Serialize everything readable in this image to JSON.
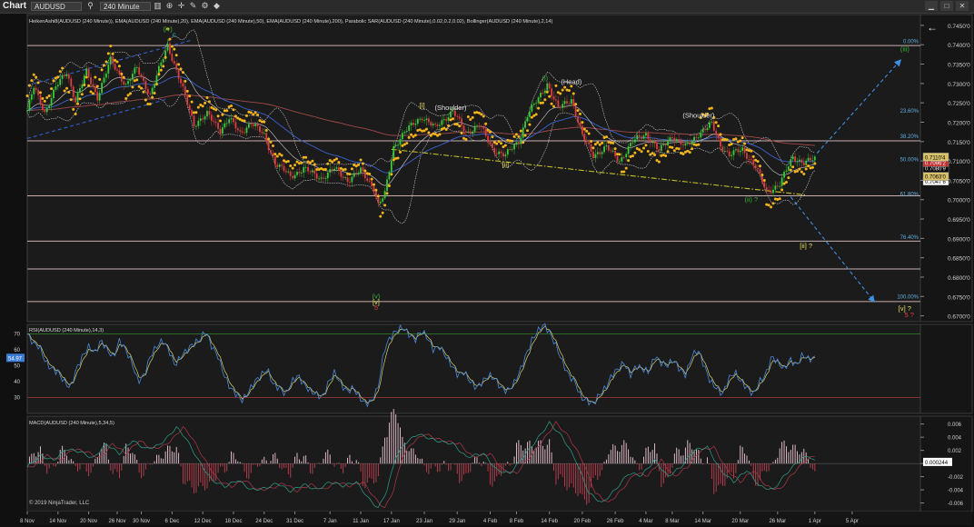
{
  "window": {
    "title": "Chart",
    "instrument": "AUDUSD",
    "timeframe": "240 Minute",
    "icons": [
      "search-icon",
      "dropdown-icon",
      "bars-icon",
      "zoom-icon",
      "crosshair-icon",
      "draw-icon",
      "settings-icon",
      "pin-icon",
      "minimize-icon",
      "maximize-icon",
      "close-icon"
    ],
    "back_arrow": "←",
    "copyright": "© 2019 NinjaTrader, LLC"
  },
  "chart_data": [
    {
      "type": "candlestick",
      "title": "HeikenAshi8(AUDUSD (240 Minute)), EMA(AUDUSD (240 Minute),20), EMA(AUDUSD (240 Minute),50), EMA(AUDUSD (240 Minute),200), Parabolic SAR(AUDUSD (240 Minute),0.02,0.2,0.02), Bollinger(AUDUSD (240 Minute),2,14)",
      "x_ticks": [
        "8 Nov",
        "14 Nov",
        "20 Nov",
        "26 Nov",
        "30 Nov",
        "6 Dec",
        "12 Dec",
        "18 Dec",
        "24 Dec",
        "31 Dec",
        "7 Jan",
        "11 Jan",
        "17 Jan",
        "23 Jan",
        "29 Jan",
        "4 Feb",
        "8 Feb",
        "14 Feb",
        "20 Feb",
        "26 Feb",
        "4 Mar",
        "8 Mar",
        "14 Mar",
        "20 Mar",
        "26 Mar",
        "1 Apr",
        "5 Apr"
      ],
      "y_ticks": [
        "0.7450'0",
        "0.7400'0",
        "0.7350'0",
        "0.7300'0",
        "0.7250'0",
        "0.7200'0",
        "0.7150'0",
        "0.7100'0",
        "0.7050'0",
        "0.7000'0",
        "0.6950'0",
        "0.6900'0",
        "0.6850'0",
        "0.6800'0",
        "0.6750'0",
        "0.6700'0"
      ],
      "ylim": [
        0.6685,
        0.7478
      ],
      "price_path": [
        [
          0,
          0.723
        ],
        [
          3,
          0.729
        ],
        [
          8,
          0.7225
        ],
        [
          13,
          0.729
        ],
        [
          18,
          0.733
        ],
        [
          22,
          0.7255
        ],
        [
          27,
          0.733
        ],
        [
          32,
          0.7265
        ],
        [
          38,
          0.736
        ],
        [
          45,
          0.7295
        ],
        [
          50,
          0.734
        ],
        [
          56,
          0.727
        ],
        [
          64,
          0.74
        ],
        [
          70,
          0.73
        ],
        [
          76,
          0.7195
        ],
        [
          82,
          0.722
        ],
        [
          88,
          0.718
        ],
        [
          92,
          0.721
        ],
        [
          97,
          0.717
        ],
        [
          102,
          0.72
        ],
        [
          108,
          0.7165
        ],
        [
          113,
          0.7095
        ],
        [
          120,
          0.706
        ],
        [
          126,
          0.708
        ],
        [
          134,
          0.7055
        ],
        [
          140,
          0.708
        ],
        [
          146,
          0.705
        ],
        [
          152,
          0.7075
        ],
        [
          158,
          0.703
        ],
        [
          160,
          0.6985
        ],
        [
          163,
          0.7015
        ],
        [
          167,
          0.7135
        ],
        [
          172,
          0.7175
        ],
        [
          180,
          0.7215
        ],
        [
          186,
          0.7185
        ],
        [
          194,
          0.723
        ],
        [
          200,
          0.717
        ],
        [
          206,
          0.7195
        ],
        [
          212,
          0.713
        ],
        [
          218,
          0.7115
        ],
        [
          224,
          0.715
        ],
        [
          228,
          0.722
        ],
        [
          233,
          0.726
        ],
        [
          237,
          0.73
        ],
        [
          242,
          0.7235
        ],
        [
          248,
          0.726
        ],
        [
          253,
          0.7165
        ],
        [
          258,
          0.7115
        ],
        [
          264,
          0.7135
        ],
        [
          270,
          0.71
        ],
        [
          276,
          0.715
        ],
        [
          282,
          0.717
        ],
        [
          288,
          0.7125
        ],
        [
          294,
          0.7165
        ],
        [
          300,
          0.7135
        ],
        [
          306,
          0.717
        ],
        [
          312,
          0.7195
        ],
        [
          316,
          0.714
        ],
        [
          320,
          0.7115
        ],
        [
          326,
          0.713
        ],
        [
          332,
          0.7085
        ],
        [
          337,
          0.702
        ],
        [
          343,
          0.704
        ],
        [
          349,
          0.711
        ],
        [
          354,
          0.7095
        ],
        [
          359,
          0.7105
        ]
      ],
      "sar_segments": [
        {
          "start": 0,
          "end": 16,
          "side": "above"
        },
        {
          "start": 17,
          "end": 30,
          "side": "below"
        },
        {
          "start": 31,
          "end": 44,
          "side": "above"
        },
        {
          "start": 45,
          "end": 63,
          "side": "below"
        },
        {
          "start": 64,
          "end": 160,
          "side": "above"
        },
        {
          "start": 161,
          "end": 200,
          "side": "below"
        },
        {
          "start": 201,
          "end": 225,
          "side": "above"
        },
        {
          "start": 226,
          "end": 240,
          "side": "below"
        },
        {
          "start": 241,
          "end": 270,
          "side": "above"
        },
        {
          "start": 271,
          "end": 306,
          "side": "below"
        },
        {
          "start": 307,
          "end": 336,
          "side": "above"
        },
        {
          "start": 337,
          "end": 359,
          "side": "below"
        }
      ],
      "horizontal_levels": [
        0.7398,
        0.7152,
        0.701,
        0.6893,
        0.6821,
        0.6737
      ],
      "fib_labels": [
        {
          "label": "0.00%",
          "price": 0.7402
        },
        {
          "label": "23.60%",
          "price": 0.7222
        },
        {
          "label": "38.20%",
          "price": 0.7157
        },
        {
          "label": "50.00%",
          "price": 0.7097
        },
        {
          "label": "61.80%",
          "price": 0.7008
        },
        {
          "label": "76.40%",
          "price": 0.6896
        },
        {
          "label": "100.00%",
          "price": 0.6742
        }
      ],
      "price_labels": [
        {
          "text": "0.7080'9",
          "color": "#ffffff",
          "fill": "#000000",
          "price": 0.7081
        },
        {
          "text": "0.7047'6",
          "color": "#000000",
          "fill": "#ffffff",
          "price": 0.7048
        },
        {
          "text": "0.7096'2",
          "color": "#ffffff",
          "fill": "#c03030",
          "price": 0.7096
        },
        {
          "text": "0.7063'0",
          "color": "#000000",
          "fill": "#d9c26a",
          "price": 0.706
        },
        {
          "text": "0.7110'4",
          "color": "#000000",
          "fill": "#d9c26a",
          "price": 0.711
        }
      ],
      "wave_labels": [
        {
          "text": "(iv)",
          "color": "#38b038",
          "i": 64,
          "price": 0.7435
        },
        {
          "text": "c",
          "color": "#38c0c0",
          "i": 67,
          "price": 0.742
        },
        {
          "text": "(v)",
          "color": "#38b038",
          "i": 159,
          "price": 0.6745
        },
        {
          "text": "[v]",
          "color": "#e8e060",
          "i": 159,
          "price": 0.673
        },
        {
          "text": "5",
          "color": "#e04040",
          "i": 159,
          "price": 0.6716
        },
        {
          "text": "[i]",
          "color": "#e8e060",
          "i": 180,
          "price": 0.7238
        },
        {
          "text": "(Shoulder)",
          "color": "#e0e0e0",
          "i": 193,
          "price": 0.7232
        },
        {
          "text": "[ii]",
          "color": "#e8e060",
          "i": 218,
          "price": 0.7085
        },
        {
          "text": "(i)",
          "color": "#38b038",
          "i": 236,
          "price": 0.7308
        },
        {
          "text": "(Head)",
          "color": "#e0e0e0",
          "i": 248,
          "price": 0.7298
        },
        {
          "text": "(Shoulder)",
          "color": "#e0e0e0",
          "i": 306,
          "price": 0.7212
        },
        {
          "text": "(ii) ?",
          "color": "#38b038",
          "i": 330,
          "price": 0.6995
        },
        {
          "text": "(iii)",
          "color": "#38b038",
          "i": 400,
          "price": 0.7383
        },
        {
          "text": "[ii] ?",
          "color": "#e8e060",
          "i": 355,
          "price": 0.6875
        },
        {
          "text": "[v] ?",
          "color": "#e8e060",
          "i": 400,
          "price": 0.6713
        },
        {
          "text": "5 ?",
          "color": "#e04040",
          "i": 402,
          "price": 0.6697
        }
      ],
      "trend_lines": [
        {
          "from": [
            0,
            0.7295
          ],
          "to": [
            75,
            0.7412
          ],
          "color": "#3060d0",
          "style": "dash"
        },
        {
          "from": [
            0,
            0.7158
          ],
          "to": [
            64,
            0.726
          ],
          "color": "#3060d0",
          "style": "dash"
        },
        {
          "from": [
            166,
            0.713
          ],
          "to": [
            355,
            0.7012
          ],
          "color": "#c8c020",
          "style": "dashdot"
        },
        {
          "from": [
            360,
            0.712
          ],
          "to": [
            398,
            0.736
          ],
          "color": "#3d8fe0",
          "style": "dash",
          "arrow": true
        },
        {
          "from": [
            348,
            0.7007
          ],
          "to": [
            386,
            0.6737
          ],
          "color": "#3d8fe0",
          "style": "dash",
          "arrow": true
        }
      ]
    },
    {
      "type": "line",
      "title": "RSI(AUDUSD (240 Minute),14,3)",
      "y_ticks": [
        "70",
        "60",
        "50",
        "40",
        "30"
      ],
      "ylim": [
        20,
        76
      ],
      "levels": [
        70,
        30
      ],
      "current_value": "54.97",
      "series": [
        {
          "values": [
            70,
            64,
            62,
            52,
            48,
            46,
            40,
            36,
            48,
            56,
            62,
            58,
            66,
            60,
            55,
            66,
            60,
            52,
            40,
            44,
            56,
            62,
            66,
            60,
            50,
            56,
            60,
            64,
            66,
            72,
            62,
            56,
            44,
            36,
            32,
            28,
            34,
            40,
            44,
            48,
            38,
            36,
            32,
            40,
            44,
            38,
            34,
            32,
            30,
            40,
            46,
            38,
            34,
            36,
            30,
            26,
            28,
            36,
            60,
            68,
            72,
            74,
            70,
            66,
            72,
            68,
            60,
            62,
            56,
            50,
            44,
            46,
            40,
            36,
            40,
            44,
            42,
            36,
            34,
            38,
            46,
            56,
            66,
            72,
            76,
            70,
            62,
            52,
            44,
            40,
            30,
            28,
            26,
            32,
            36,
            44,
            48,
            52,
            44,
            50,
            48,
            46,
            56,
            52,
            50,
            54,
            48,
            44,
            56,
            60,
            50,
            40,
            36,
            32,
            42,
            46,
            40,
            36,
            32,
            40,
            44,
            56,
            52,
            48,
            54,
            50,
            57,
            54,
            55
          ]
        }
      ]
    },
    {
      "type": "bar",
      "title": "MACD(AUDUSD (240 Minute),5,34,5)",
      "y_ticks": [
        "0.006",
        "0.004",
        "0.002",
        "0",
        "-0.002",
        "-0.004",
        "-0.006"
      ],
      "ylim": [
        -0.0073,
        0.0072
      ],
      "current_value": "0.000244",
      "macd_path": [
        [
          0,
          -0.0005
        ],
        [
          6,
          0.0012
        ],
        [
          12,
          0.0005
        ],
        [
          18,
          0.0022
        ],
        [
          24,
          0.0018
        ],
        [
          30,
          0.0008
        ],
        [
          36,
          0.003
        ],
        [
          42,
          0.0015
        ],
        [
          48,
          0.0035
        ],
        [
          54,
          0.0022
        ],
        [
          60,
          0.0028
        ],
        [
          64,
          0.004
        ],
        [
          68,
          0.0055
        ],
        [
          72,
          0.004
        ],
        [
          78,
          0.0005
        ],
        [
          84,
          -0.0025
        ],
        [
          90,
          -0.0035
        ],
        [
          96,
          -0.0025
        ],
        [
          102,
          -0.004
        ],
        [
          108,
          -0.0038
        ],
        [
          114,
          -0.003
        ],
        [
          120,
          -0.0042
        ],
        [
          126,
          -0.0032
        ],
        [
          132,
          -0.004
        ],
        [
          138,
          -0.0028
        ],
        [
          144,
          -0.0034
        ],
        [
          150,
          -0.0028
        ],
        [
          156,
          -0.0055
        ],
        [
          160,
          -0.0068
        ],
        [
          164,
          -0.004
        ],
        [
          168,
          0.001
        ],
        [
          172,
          0.003
        ],
        [
          178,
          0.0045
        ],
        [
          186,
          0.0035
        ],
        [
          194,
          0.003
        ],
        [
          200,
          0.001
        ],
        [
          208,
          0.0015
        ],
        [
          214,
          -0.001
        ],
        [
          220,
          -0.0015
        ],
        [
          226,
          0.001
        ],
        [
          232,
          0.0035
        ],
        [
          238,
          0.0062
        ],
        [
          244,
          0.004
        ],
        [
          250,
          0.0005
        ],
        [
          256,
          -0.0045
        ],
        [
          262,
          -0.006
        ],
        [
          268,
          -0.004
        ],
        [
          274,
          -0.0015
        ],
        [
          280,
          -0.0018
        ],
        [
          286,
          0.0005
        ],
        [
          292,
          -0.002
        ],
        [
          298,
          -0.0005
        ],
        [
          304,
          0.002
        ],
        [
          310,
          0.0025
        ],
        [
          316,
          -0.001
        ],
        [
          322,
          -0.0028
        ],
        [
          328,
          -0.001
        ],
        [
          334,
          -0.0035
        ],
        [
          340,
          -0.004
        ],
        [
          346,
          -0.0015
        ],
        [
          352,
          0.0005
        ],
        [
          356,
          0.0012
        ],
        [
          359,
          0.0003
        ]
      ],
      "signal_lag": 3
    }
  ]
}
